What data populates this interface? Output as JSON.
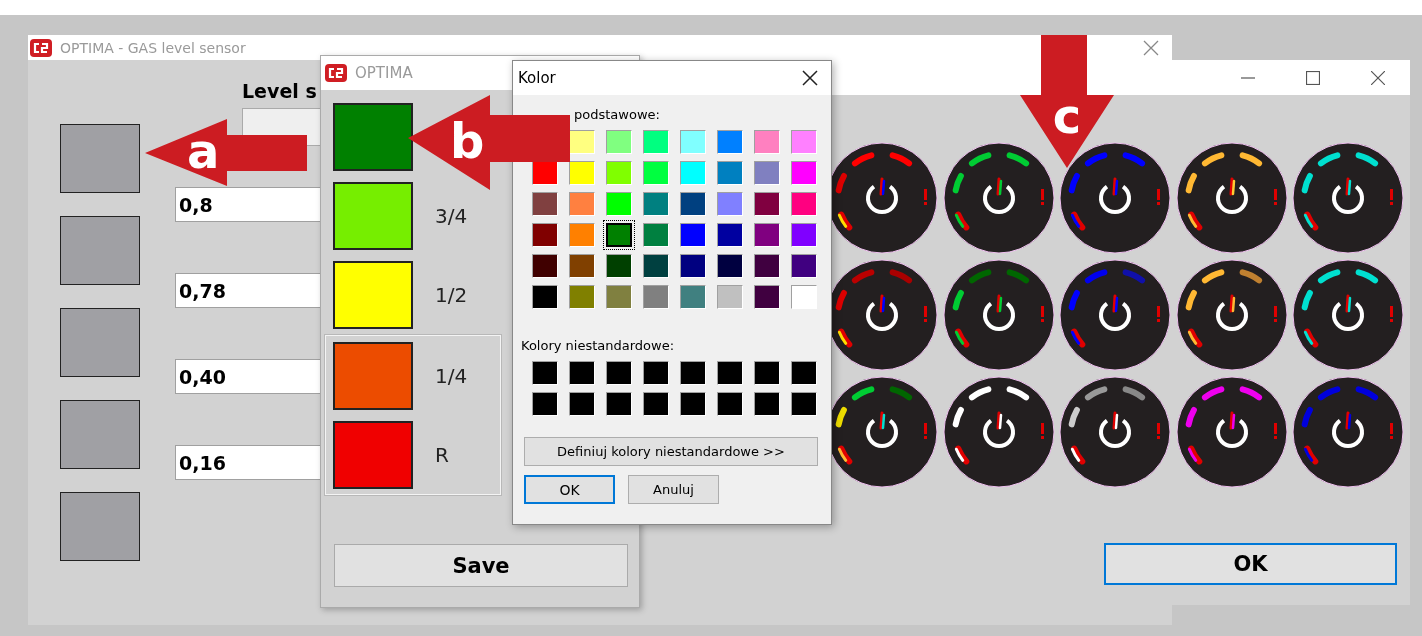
{
  "back_window": {
    "title": "OPTIMA - GAS level sensor",
    "heading": "Level s",
    "squares": [
      {
        "color": "#a0a0a4"
      },
      {
        "color": "#a0a0a4"
      },
      {
        "color": "#a0a0a4"
      },
      {
        "color": "#a0a0a4"
      },
      {
        "color": "#a0a0a4"
      }
    ],
    "fields": [
      {
        "value": "0,8"
      },
      {
        "value": "0,78"
      },
      {
        "value": "0,40"
      },
      {
        "value": "0,16"
      }
    ]
  },
  "gauge_window": {
    "gauges": [
      {
        "segments": [
          {
            "color": "#ff0000"
          },
          {
            "color": "#ff0000"
          },
          {
            "color": "#dd0000"
          },
          {
            "color": "#ffdd00"
          }
        ],
        "needle": {
          "color": "#0000ff"
        }
      },
      {
        "segments": [
          {
            "color": "#00cc33"
          },
          {
            "color": "#00cc33"
          },
          {
            "color": "#00cc33"
          },
          {
            "color": "#00cc33"
          }
        ],
        "needle": {
          "color": "#00cc33"
        }
      },
      {
        "segments": [
          {
            "color": "#0000ff"
          },
          {
            "color": "#0000ff"
          },
          {
            "color": "#0000ff"
          },
          {
            "color": "#0000ff"
          }
        ],
        "needle": {
          "color": "#0000ff"
        }
      },
      {
        "segments": [
          {
            "color": "#ffb833"
          },
          {
            "color": "#ffb833"
          },
          {
            "color": "#ffb833"
          },
          {
            "color": "#ffb833"
          }
        ],
        "needle": {
          "color": "#ffcc33"
        }
      },
      {
        "segments": [
          {
            "color": "#00e0d0"
          },
          {
            "color": "#00e0d0"
          },
          {
            "color": "#00e0d0"
          },
          {
            "color": "#00e0d0"
          }
        ],
        "needle": {
          "color": "#00e0d0"
        }
      },
      {
        "segments": [
          {
            "color": "#bb0000"
          },
          {
            "color": "#aa0000"
          },
          {
            "color": "#dd0000"
          },
          {
            "color": "#ffdd00"
          }
        ],
        "needle": {
          "color": "#0000ff"
        }
      },
      {
        "segments": [
          {
            "color": "#006600"
          },
          {
            "color": "#006600"
          },
          {
            "color": "#00cc33"
          },
          {
            "color": "#00cc33"
          }
        ],
        "needle": {
          "color": "#00cc33"
        }
      },
      {
        "segments": [
          {
            "color": "#0000ee"
          },
          {
            "color": "#1010aa"
          },
          {
            "color": "#0000ff"
          },
          {
            "color": "#0000ff"
          }
        ],
        "needle": {
          "color": "#0000ff"
        }
      },
      {
        "segments": [
          {
            "color": "#ffb833"
          },
          {
            "color": "#c08030"
          },
          {
            "color": "#ffb833"
          },
          {
            "color": "#ffb833"
          }
        ],
        "needle": {
          "color": "#ffb833"
        }
      },
      {
        "segments": [
          {
            "color": "#00e0d0"
          },
          {
            "color": "#00e0d0"
          },
          {
            "color": "#00e0d0"
          },
          {
            "color": "#00e0d0"
          }
        ],
        "needle": {
          "color": "#00e0d0"
        }
      },
      {
        "segments": [
          {
            "color": "#00cc33"
          },
          {
            "color": "#006600"
          },
          {
            "color": "#eedd00"
          },
          {
            "color": "#ffb833"
          }
        ],
        "needle": {
          "color": "#00e0d0"
        }
      },
      {
        "segments": [
          {
            "color": "#ffffff"
          },
          {
            "color": "#ffffff"
          },
          {
            "color": "#ffffff"
          },
          {
            "color": "#ffffff"
          }
        ],
        "needle": {
          "color": "#ffffff"
        }
      },
      {
        "segments": [
          {
            "color": "#999999"
          },
          {
            "color": "#888888"
          },
          {
            "color": "#cccccc"
          },
          {
            "color": "#ffffff"
          }
        ],
        "needle": {
          "color": "#ffffff"
        }
      },
      {
        "segments": [
          {
            "color": "#ee00ee"
          },
          {
            "color": "#ee00ee"
          },
          {
            "color": "#ee00ee"
          },
          {
            "color": "#ee00ee"
          }
        ],
        "needle": {
          "color": "#ee00ee"
        }
      },
      {
        "segments": [
          {
            "color": "#0000dd"
          },
          {
            "color": "#0000dd"
          },
          {
            "color": "#0000dd"
          },
          {
            "color": "#0000dd"
          }
        ],
        "needle": {
          "color": "#0000dd"
        }
      }
    ],
    "ok_button": "OK"
  },
  "levels_dialog": {
    "title": "OPTIMA",
    "levels": [
      {
        "color": "#008000"
      },
      {
        "color": "#76ee00",
        "label": "3/4"
      },
      {
        "color": "#ffff00",
        "label": "1/2"
      }
    ],
    "framed_levels": [
      {
        "color": "#ec4c00",
        "label": "1/4"
      },
      {
        "color": "#f00000",
        "label": "R"
      }
    ],
    "save_button": "Save"
  },
  "color_dialog": {
    "title": "Kolor",
    "basic_label": "podstawowe:",
    "basic_rows": [
      [
        {
          "color": "#ffff80",
          "selected": false
        },
        {
          "color": "#80ff80",
          "selected": false
        },
        {
          "color": "#00ff80",
          "selected": false
        },
        {
          "color": "#80ffff",
          "selected": false
        },
        {
          "color": "#0080ff",
          "selected": false
        },
        {
          "color": "#ff80c0",
          "selected": false
        },
        {
          "color": "#ff80ff",
          "selected": false
        }
      ],
      [
        {
          "color": "#ff0000",
          "selected": false
        },
        {
          "color": "#ffff00",
          "selected": false
        },
        {
          "color": "#80ff00",
          "selected": false
        },
        {
          "color": "#00ff40",
          "selected": false
        },
        {
          "color": "#00ffff",
          "selected": false
        },
        {
          "color": "#0080c0",
          "selected": false
        },
        {
          "color": "#8080c0",
          "selected": false
        },
        {
          "color": "#ff00ff",
          "selected": false
        }
      ],
      [
        {
          "color": "#804040",
          "selected": false
        },
        {
          "color": "#ff8040",
          "selected": false
        },
        {
          "color": "#00ff00",
          "selected": false
        },
        {
          "color": "#008080",
          "selected": false
        },
        {
          "color": "#004080",
          "selected": false
        },
        {
          "color": "#8080ff",
          "selected": false
        },
        {
          "color": "#800040",
          "selected": false
        },
        {
          "color": "#ff0080",
          "selected": false
        }
      ],
      [
        {
          "color": "#800000",
          "selected": false
        },
        {
          "color": "#ff8000",
          "selected": false
        },
        {
          "color": "#008000",
          "selected": true
        },
        {
          "color": "#008040",
          "selected": false
        },
        {
          "color": "#0000ff",
          "selected": false
        },
        {
          "color": "#0000a0",
          "selected": false
        },
        {
          "color": "#800080",
          "selected": false
        },
        {
          "color": "#8000ff",
          "selected": false
        }
      ],
      [
        {
          "color": "#400000",
          "selected": false
        },
        {
          "color": "#804000",
          "selected": false
        },
        {
          "color": "#004000",
          "selected": false
        },
        {
          "color": "#004040",
          "selected": false
        },
        {
          "color": "#000080",
          "selected": false
        },
        {
          "color": "#000040",
          "selected": false
        },
        {
          "color": "#400040",
          "selected": false
        },
        {
          "color": "#400080",
          "selected": false
        }
      ],
      [
        {
          "color": "#000000",
          "selected": false
        },
        {
          "color": "#808000",
          "selected": false
        },
        {
          "color": "#808040",
          "selected": false
        },
        {
          "color": "#808080",
          "selected": false
        },
        {
          "color": "#408080",
          "selected": false
        },
        {
          "color": "#c0c0c0",
          "selected": false
        },
        {
          "color": "#400040",
          "selected": false
        },
        {
          "color": "#ffffff",
          "selected": false
        }
      ]
    ],
    "custom_label": "Kolory niestandardowe:",
    "custom_rows": [
      [
        {
          "color": "#000000"
        },
        {
          "color": "#000000"
        },
        {
          "color": "#000000"
        },
        {
          "color": "#000000"
        },
        {
          "color": "#000000"
        },
        {
          "color": "#000000"
        },
        {
          "color": "#000000"
        },
        {
          "color": "#000000"
        }
      ],
      [
        {
          "color": "#000000"
        },
        {
          "color": "#000000"
        },
        {
          "color": "#000000"
        },
        {
          "color": "#000000"
        },
        {
          "color": "#000000"
        },
        {
          "color": "#000000"
        },
        {
          "color": "#000000"
        },
        {
          "color": "#000000"
        }
      ]
    ],
    "define_button": "Definiuj kolory niestandardowe >>",
    "ok_button": "OK",
    "cancel_button": "Anuluj"
  },
  "callouts": [
    {
      "letter": "a"
    },
    {
      "letter": "b"
    },
    {
      "letter": "c"
    }
  ]
}
